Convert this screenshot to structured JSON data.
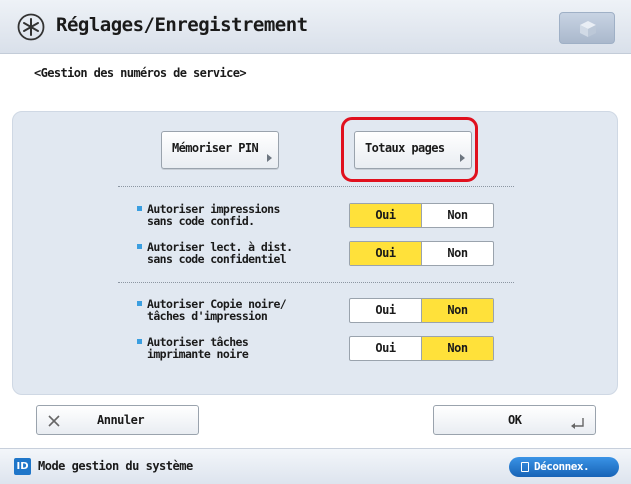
{
  "header": {
    "title": "Réglages/Enregistrement",
    "settings_icon": "settings-star-icon",
    "corner_icon": "cube-icon"
  },
  "subtitle": "<Gestion des numéros de service>",
  "panel": {
    "buttons": {
      "memoriser_pin": "Mémoriser PIN",
      "totaux_pages": "Totaux pages"
    },
    "settings": [
      {
        "label_line1": "Autoriser impressions",
        "label_line2": "sans code confid.",
        "options": [
          "Oui",
          "Non"
        ],
        "selected": "Oui"
      },
      {
        "label_line1": "Autoriser lect. à dist.",
        "label_line2": "sans code confidentiel",
        "options": [
          "Oui",
          "Non"
        ],
        "selected": "Oui"
      },
      {
        "label_line1": "Autoriser Copie noire/",
        "label_line2": "tâches d'impression",
        "options": [
          "Oui",
          "Non"
        ],
        "selected": "Non"
      },
      {
        "label_line1": "Autoriser tâches",
        "label_line2": "imprimante noire",
        "options": [
          "Oui",
          "Non"
        ],
        "selected": "Non"
      }
    ]
  },
  "footer": {
    "cancel_label": "Annuler",
    "ok_label": "OK"
  },
  "statusbar": {
    "mode_badge": "ID",
    "mode_text": "Mode gestion du système",
    "logout_label": "Déconnex."
  },
  "colors": {
    "selected": "#ffe13a",
    "highlight": "#e0101e",
    "accent": "#1f76c9",
    "panel": "#e1e8f1"
  }
}
